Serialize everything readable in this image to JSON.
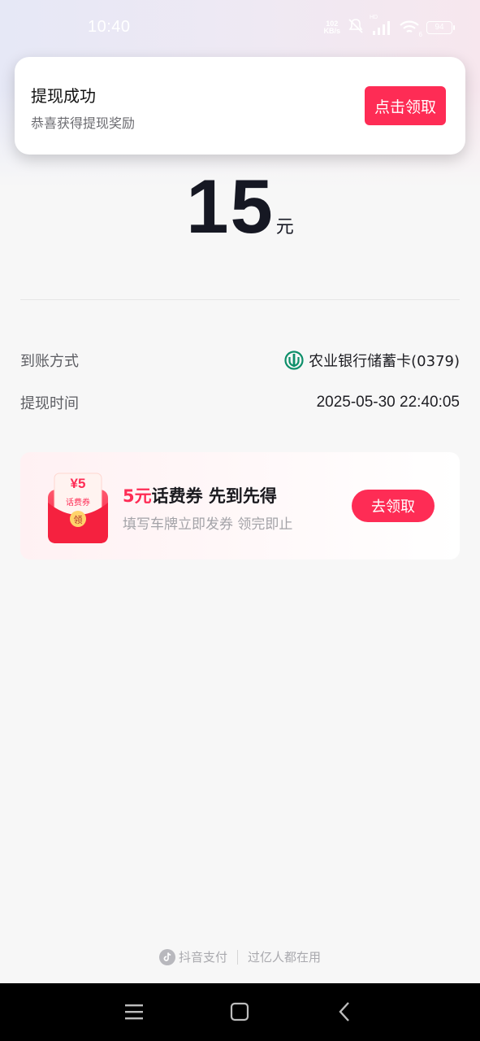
{
  "status_bar": {
    "time": "10:40",
    "net_speed_value": "102",
    "net_speed_unit": "KB/s",
    "hd_label": "HD",
    "wifi_badge": "6",
    "battery": "94"
  },
  "notification": {
    "title": "提现成功",
    "subtitle": "恭喜获得提现奖励",
    "button_label": "点击领取"
  },
  "amount": {
    "value": "15",
    "unit": "元"
  },
  "details": {
    "method_label": "到账方式",
    "method_value": "农业银行储蓄卡(0379)",
    "time_label": "提现时间",
    "time_value": "2025-05-30 22:40:05"
  },
  "coupon": {
    "art_value": "¥5",
    "art_label": "话费券",
    "art_badge": "领",
    "title_accent": "5元",
    "title_rest": "话费券 先到先得",
    "subtitle": "填写车牌立即发券 领完即止",
    "button_label": "去领取"
  },
  "footer": {
    "brand": "抖音支付",
    "slogan": "过亿人都在用"
  },
  "colors": {
    "accent": "#fe2c55",
    "bank_green": "#0e8f6a"
  },
  "icons": {
    "bank": "abc-bank-icon",
    "footer": "douyin-logo-icon",
    "nav_menu": "menu-icon",
    "nav_home": "home-icon",
    "nav_back": "back-icon"
  }
}
